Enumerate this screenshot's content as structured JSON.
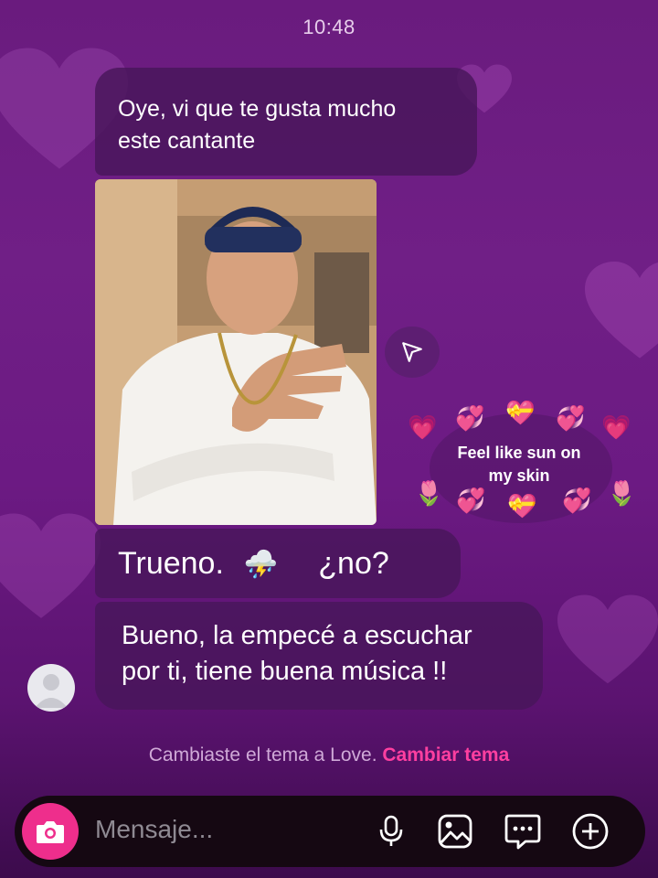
{
  "status_bar": {
    "time": "10:48"
  },
  "colors": {
    "accent": "#ee2e8c",
    "link": "#ff3fa0",
    "bubble": "#48165a",
    "background": "#6a1b7e"
  },
  "messages": [
    {
      "text_line1": "Oye, vi que te gusta mucho",
      "text_line2": "este cantante"
    },
    {
      "type": "shared-photo",
      "description_icon": "photo-of-singer"
    },
    {
      "word1": "Trueno.",
      "emoji": "⛈️",
      "word2": "¿no?"
    },
    {
      "line1": "Bueno, la empecé a escuchar",
      "line2": "por ti, tiene buena música !!"
    }
  ],
  "sticker": {
    "line1": "Feel like sun on",
    "line2": "my skin"
  },
  "notice": {
    "text": "Cambiaste el tema a Love.",
    "link": "Cambiar tema"
  },
  "composer": {
    "placeholder": "Mensaje...",
    "icons": [
      "camera-icon",
      "microphone-icon",
      "gallery-icon",
      "sticker-icon",
      "plus-icon"
    ]
  }
}
